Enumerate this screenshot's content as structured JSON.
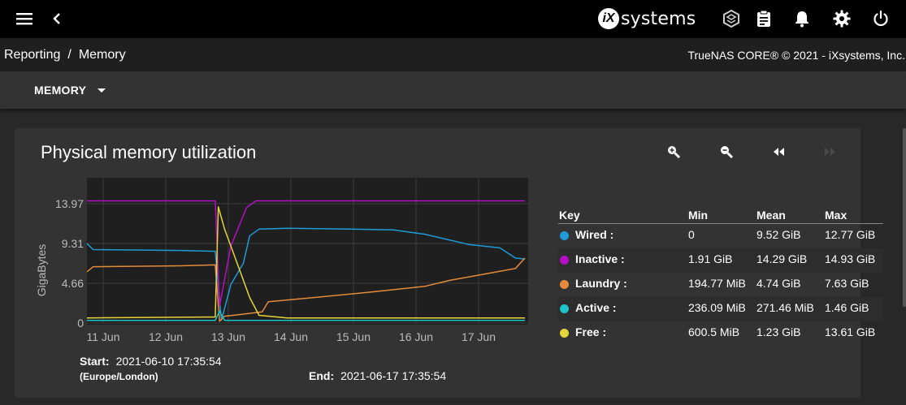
{
  "topbar": {
    "menu_icon": "hamburger-menu-icon",
    "back_icon": "chevron-left-icon",
    "brand_mark": "iX",
    "brand_text": "systems",
    "right_icons": [
      "truecommand-icon",
      "task-manager-icon",
      "notifications-icon",
      "settings-gear-icon",
      "power-icon"
    ]
  },
  "breadcrumb": {
    "items": [
      "Reporting",
      "Memory"
    ],
    "separator": "/"
  },
  "copyright": "TrueNAS CORE® © 2021 - iXsystems, Inc.",
  "toolbar": {
    "menu_label": "MEMORY"
  },
  "card": {
    "title": "Physical memory utilization",
    "tools": [
      "zoom-in-icon",
      "zoom-out-icon",
      "step-back-icon",
      "step-forward-icon"
    ]
  },
  "key_table": {
    "headers": {
      "key": "Key",
      "min": "Min",
      "mean": "Mean",
      "max": "Max"
    },
    "rows": [
      {
        "label": "Wired :",
        "color": "#1e9bd8",
        "min": "0",
        "mean": "9.52 GiB",
        "max": "12.77 GiB"
      },
      {
        "label": "Inactive :",
        "color": "#b40fc4",
        "min": "1.91 GiB",
        "mean": "14.29 GiB",
        "max": "14.93 GiB"
      },
      {
        "label": "Laundry :",
        "color": "#e58b3a",
        "min": "194.77 MiB",
        "mean": "4.74 GiB",
        "max": "7.63 GiB"
      },
      {
        "label": "Active :",
        "color": "#1ec4c8",
        "min": "236.09 MiB",
        "mean": "271.46 MiB",
        "max": "1.46 GiB"
      },
      {
        "label": "Free :",
        "color": "#e6d43a",
        "min": "600.5 MiB",
        "mean": "1.23 GiB",
        "max": "13.61 GiB"
      }
    ]
  },
  "range": {
    "start_label": "Start:",
    "start_value": "2021-06-10 17:35:54",
    "timezone": "(Europe/London)",
    "end_label": "End:",
    "end_value": "2021-06-17 17:35:54"
  },
  "chart_data": {
    "type": "line",
    "ylabel": "GigaBytes",
    "xlabel": "",
    "y_ticks": [
      "0",
      "4.66",
      "9.31",
      "13.97"
    ],
    "x_ticks": [
      "11 Jun",
      "12 Jun",
      "13 Jun",
      "14 Jun",
      "15 Jun",
      "16 Jun",
      "17 Jun"
    ],
    "ylim": [
      0,
      15.5
    ],
    "x_range_days": [
      0,
      7
    ],
    "grid": true,
    "series": [
      {
        "name": "Wired",
        "color": "#1e9bd8",
        "points": [
          [
            0,
            9.3
          ],
          [
            0.1,
            8.6
          ],
          [
            1.5,
            8.5
          ],
          [
            2.05,
            8.4
          ],
          [
            2.15,
            0.3
          ],
          [
            2.3,
            4.5
          ],
          [
            2.5,
            7
          ],
          [
            2.6,
            10.2
          ],
          [
            2.75,
            11
          ],
          [
            3.2,
            11.1
          ],
          [
            4.2,
            11
          ],
          [
            4.9,
            10.9
          ],
          [
            5.4,
            10.4
          ],
          [
            6.1,
            9.2
          ],
          [
            6.6,
            8.8
          ],
          [
            6.85,
            7.6
          ],
          [
            7,
            7.5
          ]
        ]
      },
      {
        "name": "Inactive",
        "color": "#b40fc4",
        "points": [
          [
            0,
            14.3
          ],
          [
            2.05,
            14.3
          ],
          [
            2.12,
            2
          ],
          [
            2.3,
            9
          ],
          [
            2.55,
            13.5
          ],
          [
            2.7,
            14.3
          ],
          [
            7,
            14.3
          ]
        ]
      },
      {
        "name": "Laundry",
        "color": "#e58b3a",
        "points": [
          [
            0,
            6
          ],
          [
            0.1,
            6.6
          ],
          [
            1.5,
            6.7
          ],
          [
            2.05,
            6.8
          ],
          [
            2.12,
            0.2
          ],
          [
            2.2,
            0.8
          ],
          [
            2.45,
            1
          ],
          [
            2.8,
            1.3
          ],
          [
            2.9,
            2.5
          ],
          [
            3.5,
            2.9
          ],
          [
            4.5,
            3.6
          ],
          [
            5.4,
            4.3
          ],
          [
            5.8,
            5
          ],
          [
            6.1,
            5.4
          ],
          [
            6.85,
            6.4
          ],
          [
            7,
            7.6
          ]
        ]
      },
      {
        "name": "Active",
        "color": "#1ec4c8",
        "points": [
          [
            0,
            0.3
          ],
          [
            2.05,
            0.3
          ],
          [
            2.12,
            1.4
          ],
          [
            2.2,
            0.3
          ],
          [
            7,
            0.3
          ]
        ]
      },
      {
        "name": "Free",
        "color": "#e6d43a",
        "points": [
          [
            0,
            0.6
          ],
          [
            2.05,
            0.7
          ],
          [
            2.1,
            13.6
          ],
          [
            2.2,
            11
          ],
          [
            2.35,
            8
          ],
          [
            2.6,
            3
          ],
          [
            2.75,
            0.9
          ],
          [
            3.2,
            0.6
          ],
          [
            7,
            0.6
          ]
        ]
      }
    ]
  }
}
